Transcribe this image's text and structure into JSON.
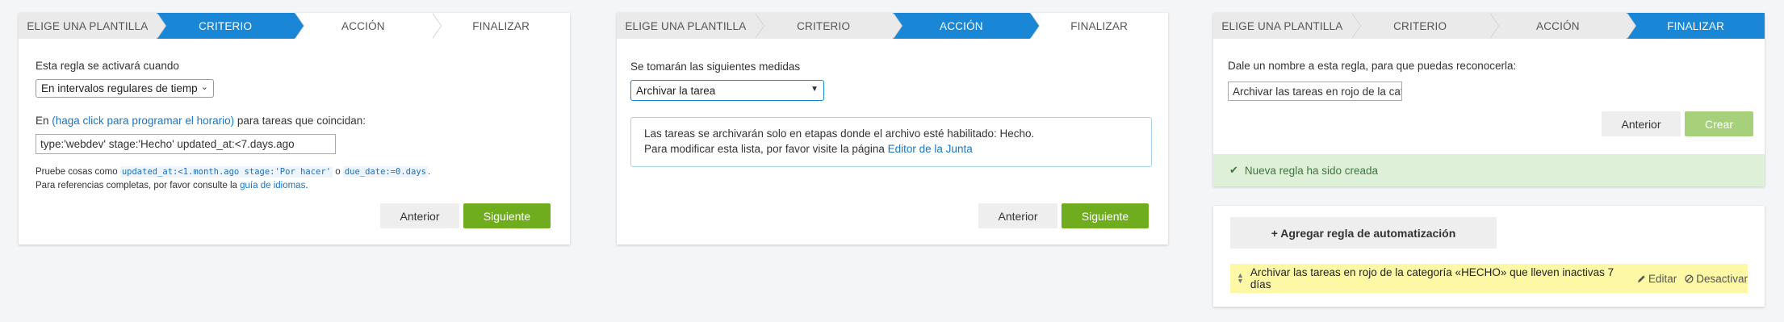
{
  "steps": {
    "template": "ELIGE UNA PLANTILLA",
    "criteria": "CRITERIO",
    "action": "ACCIÓN",
    "finish": "FINALIZAR"
  },
  "panel1": {
    "trigger_label": "Esta regla se activará cuando",
    "trigger_select": "En intervalos regulares de tiemp",
    "schedule_prefix": "En ",
    "schedule_link": "(haga click para programar el horario)",
    "schedule_suffix": " para tareas que coincidan:",
    "query_value": "type:'webdev' stage:'Hecho' updated_at:<7.days.ago",
    "try_prefix": "Pruebe cosas como ",
    "try_code1": "updated_at:<1.month.ago stage:'Por hacer'",
    "try_or": " o ",
    "try_code2": "due_date:=0.days",
    "try_end": ".",
    "ref_prefix": "Para referencias completas, por favor consulte la ",
    "ref_link": "guía de idiomas",
    "ref_end": ".",
    "back": "Anterior",
    "next": "Siguiente"
  },
  "panel2": {
    "measures_label": "Se tomarán las siguientes medidas",
    "action_select": "Archivar la tarea",
    "info_line1": "Las tareas se archivarán solo en etapas donde el archivo esté habilitado: Hecho.",
    "info_line2_prefix": "Para modificar esta lista, por favor visite la página ",
    "info_link": "Editor de la Junta",
    "back": "Anterior",
    "next": "Siguiente"
  },
  "panel3": {
    "name_label": "Dale un nombre a esta regla, para que puedas reconocerla:",
    "name_value": "Archivar las tareas en rojo de la cate",
    "back": "Anterior",
    "create": "Crear",
    "success": "Nueva regla ha sido creada"
  },
  "panel4": {
    "add_rule": "+ Agregar regla de automatización",
    "rule_text": "Archivar las tareas en rojo de la categoría «HECHO» que lleven inactivas 7 días",
    "edit": "Editar",
    "disable": "Desactivar"
  }
}
